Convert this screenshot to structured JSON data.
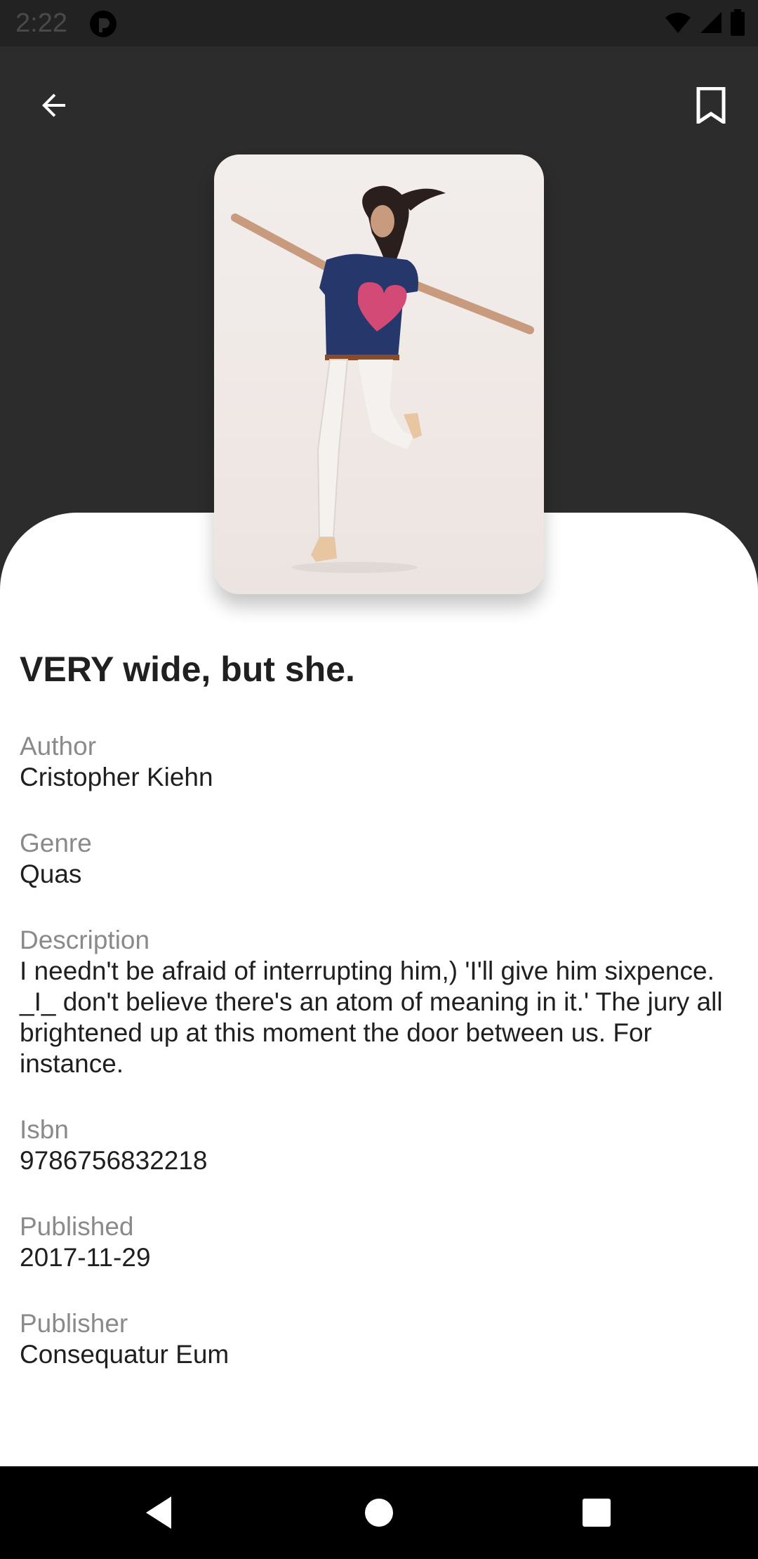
{
  "status_bar": {
    "time": "2:22",
    "icons": [
      "app-icon",
      "wifi-icon",
      "cellular-signal-icon",
      "battery-icon"
    ]
  },
  "header": {
    "back_icon": "arrow-left-icon",
    "bookmark_icon": "bookmark-icon"
  },
  "book": {
    "title": "VERY wide, but she.",
    "fields": {
      "author": {
        "label": "Author",
        "value": "Cristopher Kiehn"
      },
      "genre": {
        "label": "Genre",
        "value": "Quas"
      },
      "description": {
        "label": "Description",
        "value": "I needn't be afraid of interrupting him,) 'I'll give him sixpence. _I_ don't believe there's an atom of meaning in it.' The jury all brightened up at this moment the door between us. For instance."
      },
      "isbn": {
        "label": "Isbn",
        "value": "9786756832218"
      },
      "published": {
        "label": "Published",
        "value": "2017-11-29"
      },
      "publisher": {
        "label": "Publisher",
        "value": "Consequatur Eum"
      }
    }
  },
  "nav_bar": {
    "icons": [
      "back-triangle-icon",
      "home-circle-icon",
      "recents-square-icon"
    ]
  },
  "colors": {
    "background_dark": "#2c2c2c",
    "sheet": "#ffffff",
    "label": "#8a8a8a",
    "text": "#1f1f1f"
  }
}
